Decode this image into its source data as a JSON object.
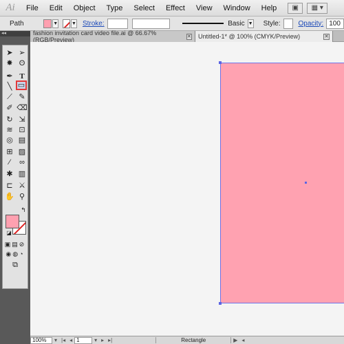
{
  "app": {
    "logo": "Ai"
  },
  "menu": [
    "File",
    "Edit",
    "Object",
    "Type",
    "Select",
    "Effect",
    "View",
    "Window",
    "Help"
  ],
  "control_bar": {
    "selection": "Path",
    "fill_color": "#ffa0b0",
    "stroke_label": "Stroke:",
    "brush_label": "Basic",
    "style_label": "Style:",
    "opacity_label": "Opacity:",
    "opacity_value": "100"
  },
  "tabs": [
    {
      "title": "fashion invitation card video file.ai @ 66.67% (RGB/Preview)",
      "active": false
    },
    {
      "title": "Untitled-1* @ 100% (CMYK/Preview)",
      "active": true
    }
  ],
  "tools": {
    "selected": "rectangle-tool",
    "fill_color": "#ffa0b0"
  },
  "canvas": {
    "artboard_fill": "#ffa2b1",
    "artboard_stroke": "#6d72e8"
  },
  "status_bar": {
    "zoom": "100%",
    "artboard_number": "1",
    "current_tool": "Rectangle"
  }
}
